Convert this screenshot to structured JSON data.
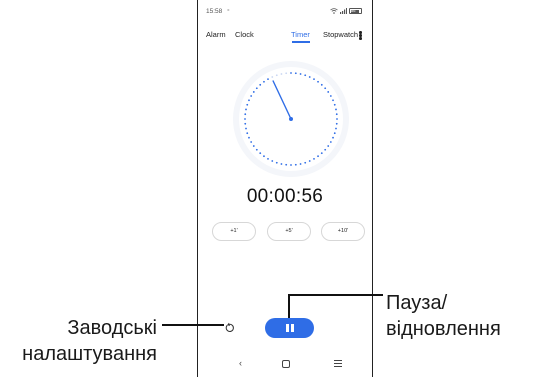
{
  "status": {
    "time": "15:58",
    "notif": "⁎",
    "battery": "86"
  },
  "tabs": [
    {
      "label": "Alarm"
    },
    {
      "label": "Clock"
    },
    {
      "label": "Timer"
    },
    {
      "label": "Stopwatch"
    }
  ],
  "active_tab": "Timer",
  "timer": {
    "display": "00:00:56",
    "dial_progress": 0.93,
    "add_buttons": [
      "+1'",
      "+5'",
      "+10'"
    ]
  },
  "callouts": {
    "reset_line1": "Заводські",
    "reset_line2": "налаштування",
    "pause_line1": "Пауза/",
    "pause_line2": "відновлення"
  },
  "colors": {
    "accent": "#2f6de6",
    "text": "#222222",
    "border": "#d7d7d7"
  },
  "icons": [
    "wifi-icon",
    "signal-icon",
    "battery-icon",
    "menu-icon",
    "reset-icon",
    "pause-icon",
    "back-icon",
    "home-icon",
    "recents-icon"
  ]
}
